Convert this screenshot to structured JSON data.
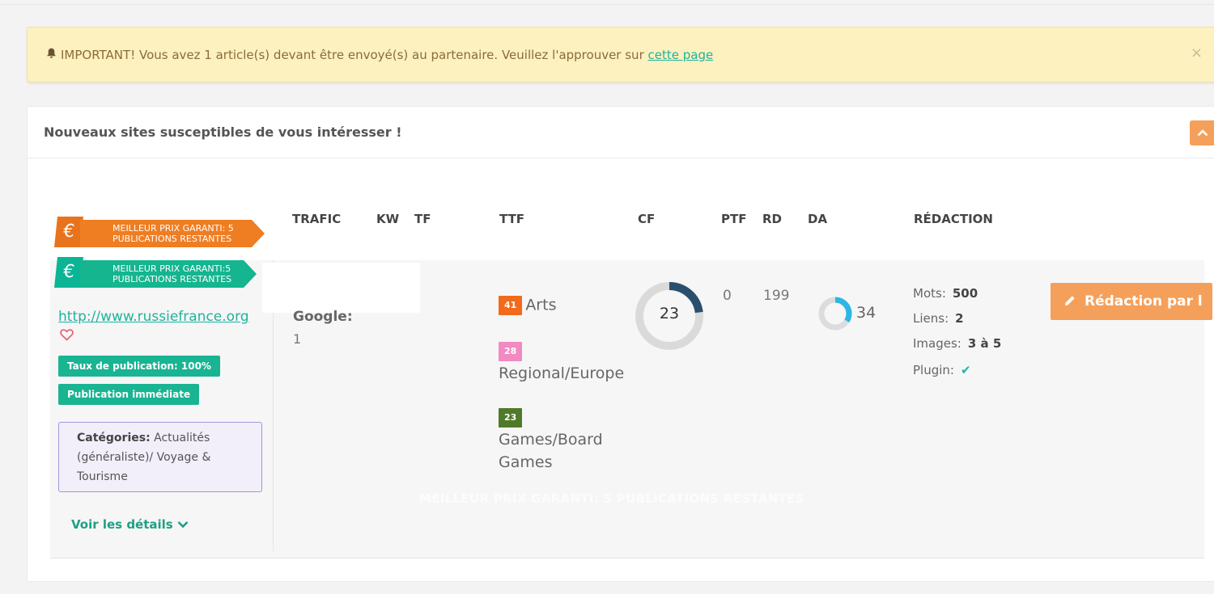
{
  "alert": {
    "bell_icon": "bell-icon",
    "message": "IMPORTANT! Vous avez 1 article(s) devant être envoyé(s) au partenaire. Veuillez l'approuver sur",
    "link_text": "cette page",
    "close_symbol": "×"
  },
  "panel": {
    "title": "Nouveaux sites susceptibles de vous intéresser !",
    "collapse_symbol": "⌃"
  },
  "columns": {
    "trafic": "TRAFIC",
    "kw": "KW",
    "tf": "TF",
    "ttf": "TTF",
    "cf": "CF",
    "ptf": "PTF",
    "rd": "RD",
    "da": "DA",
    "redaction": "RÉDACTION"
  },
  "ribbons": [
    {
      "euro": "€",
      "text": "MEILLEUR PRIX GARANTI: 5 PUBLICATIONS RESTANTES",
      "color": "#ef7d22"
    },
    {
      "euro": "€",
      "text": "MEILLEUR PRIX GARANTI:5 PUBLICATIONS RESTANTES",
      "color": "#14b58f"
    }
  ],
  "site": {
    "url": "http://www.russiefrance.org",
    "heart_icon": "heart-icon",
    "badge_rate": "Taux de publication: 100%",
    "badge_immediate": "Publication immédiate",
    "categories_label": "Catégories:",
    "categories_value": "Actualités (généraliste)/ Voyage & Tourisme",
    "details_link": "Voir les détails",
    "traffic_label": "Google:",
    "traffic_value": "1",
    "ttf": [
      {
        "value": "41",
        "label": "Arts",
        "color": "#f26a1b"
      },
      {
        "value": "28",
        "label": "Regional/Europe",
        "color": "#f08ac0"
      },
      {
        "value": "23",
        "label": "Games/Board Games",
        "color": "#4f7a2a"
      }
    ],
    "cf": "23",
    "cf_fraction": 0.23,
    "ptf": "0",
    "rd": "199",
    "da": "34",
    "da_fraction": 0.34,
    "redaction": {
      "mots_label": "Mots:",
      "mots_value": "500",
      "liens_label": "Liens:",
      "liens_value": "2",
      "images_label": "Images:",
      "images_value": "3 à 5",
      "plugin_label": "Plugin:",
      "plugin_value": "✔"
    },
    "button_label": "Rédaction par l",
    "button_icon": "pencil-icon"
  },
  "ghost_text": "MEILLEUR PRIX GARANTI: 5 PUBLICATIONS RESTANTES"
}
